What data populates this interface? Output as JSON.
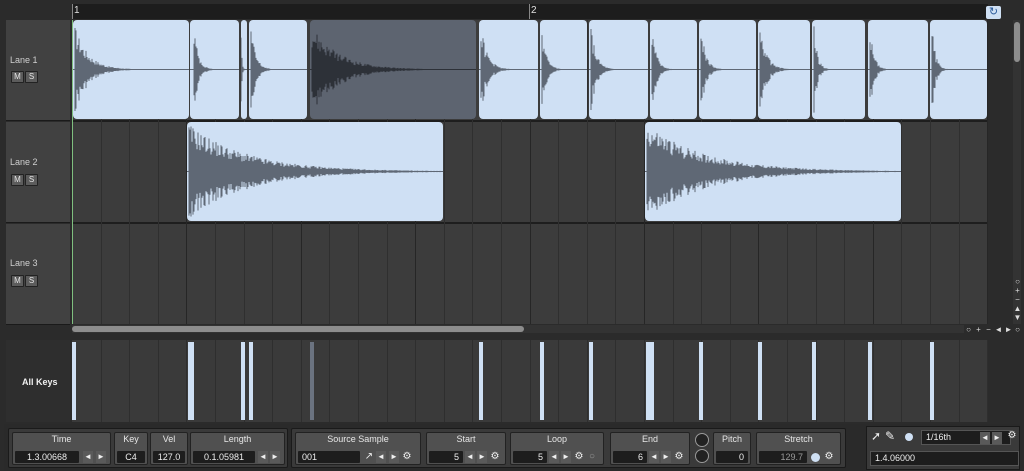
{
  "ruler": {
    "bar1": "1",
    "bar2": "2",
    "loop_icon": "loop-icon"
  },
  "lanes": [
    {
      "name": "Lane 1",
      "mute": "M",
      "solo": "S"
    },
    {
      "name": "Lane 2",
      "mute": "M",
      "solo": "S"
    },
    {
      "name": "Lane 3",
      "mute": "M",
      "solo": "S"
    }
  ],
  "keys_label": "All Keys",
  "colors": {
    "clip": "#cfe0f4",
    "clip_selected": "#5d6470",
    "wave": "#5f6875",
    "background": "#2b2b2b"
  },
  "zoom": {
    "h_out": "○",
    "h_in": "+",
    "h_minus": "−",
    "h_left": "◄",
    "h_right": "►",
    "h_reset": "○",
    "v_reset": "○",
    "v_in": "+",
    "v_minus": "−",
    "v_up": "▲",
    "v_down": "▼",
    "v_bottom": "○"
  },
  "event": {
    "time_label": "Time",
    "time_value": "1.3.00668",
    "key_label": "Key",
    "key_value": "C4",
    "vel_label": "Vel",
    "vel_value": "127.0",
    "length_label": "Length",
    "length_value": "0.1.05981"
  },
  "sample": {
    "source_label": "Source Sample",
    "source_value": "001",
    "start_label": "Start",
    "start_value": "5",
    "loop_label": "Loop",
    "loop_value": "5",
    "end_label": "End",
    "end_value": "6",
    "pitch_label": "Pitch",
    "pitch_value": "0",
    "stretch_label": "Stretch",
    "stretch_value": "129.7"
  },
  "tools": {
    "snap_value": "1/16th",
    "position_value": "1.4.06000"
  },
  "arrows": {
    "left": "◄",
    "right": "►",
    "gear": "⚙",
    "link": "↗"
  }
}
